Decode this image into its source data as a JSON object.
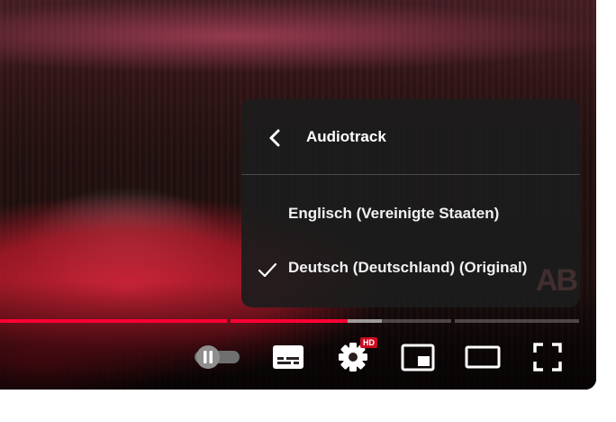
{
  "settings_menu": {
    "title": "Audiotrack",
    "items": [
      {
        "label": "Englisch (Vereinigte Staaten)",
        "selected": false
      },
      {
        "label": "Deutsch (Deutschland) (Original)",
        "selected": true
      }
    ]
  },
  "progress": {
    "played_fraction": 0.6,
    "buffered_fraction": 0.66,
    "color_played": "#ff0033"
  },
  "controls": {
    "quality_badge": "HD",
    "autoplay_state": "paused",
    "icons": [
      "pause-icon",
      "subtitles-icon",
      "gear-icon",
      "miniplayer-icon",
      "theater-mode-icon",
      "fullscreen-icon"
    ]
  },
  "colors": {
    "accent": "#ff0033",
    "badge": "#cc0a1e",
    "menu_bg": "#1c1c1c"
  }
}
